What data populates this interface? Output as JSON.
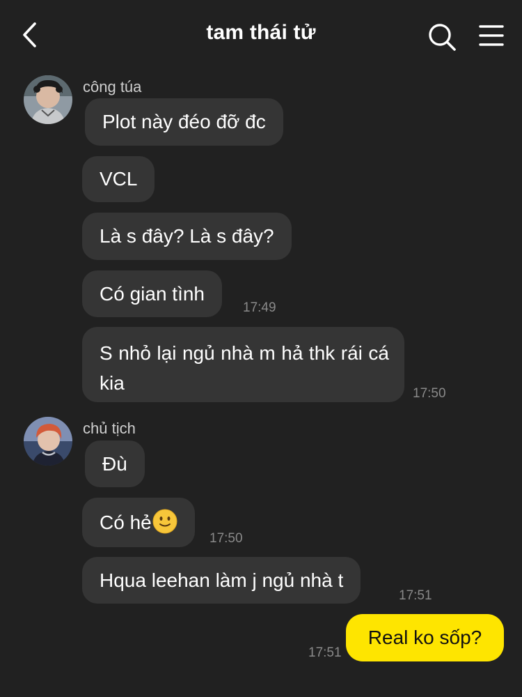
{
  "header": {
    "title": "tam thái tử"
  },
  "icons": {
    "back": "chevron-left-icon",
    "search": "search-icon",
    "menu": "hamburger-menu-icon",
    "emoji": "slightly-smiling-face-emoji"
  },
  "colors": {
    "background": "#212121",
    "bubble_other": "#353535",
    "bubble_mine": "#fee500"
  },
  "messages": {
    "group1": {
      "sender": "công túa",
      "m1": "Plot này đéo đỡ đc",
      "m2": "VCL",
      "m3": "Là s đây? Là s đây?",
      "m4": "Có gian tình",
      "t4": "17:49",
      "m5": "S nhỏ lại ngủ nhà m hả thk rái cá kia",
      "t5": "17:50"
    },
    "group2": {
      "sender": "chủ tịch",
      "m1": "Đù",
      "m2": "Có hẻ",
      "t2": "17:50",
      "m3": "Hqua leehan làm j ngủ nhà t",
      "t3": "17:51"
    },
    "mine": {
      "m1": "Real ko sốp?",
      "t1": "17:51"
    }
  }
}
